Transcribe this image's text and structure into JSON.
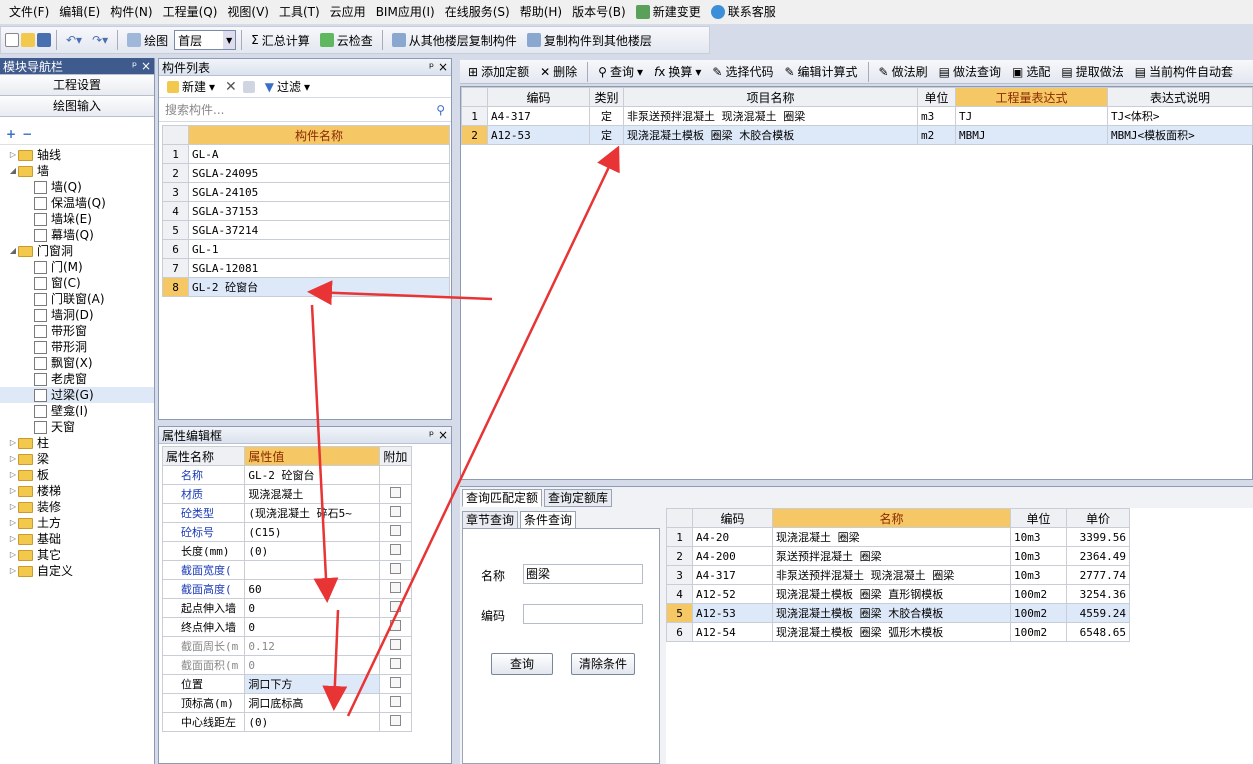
{
  "menu": [
    "文件(F)",
    "编辑(E)",
    "构件(N)",
    "工程量(Q)",
    "视图(V)",
    "工具(T)",
    "云应用",
    "BIM应用(I)",
    "在线服务(S)",
    "帮助(H)",
    "版本号(B)"
  ],
  "menu_extra": [
    "新建变更",
    "联系客服"
  ],
  "toolbar": {
    "draw": "绘图",
    "floor": "首层",
    "sum": "汇总计算",
    "cloud_check": "云检查",
    "copy_from": "从其他楼层复制构件",
    "copy_to": "复制构件到其他楼层"
  },
  "nav": {
    "title": "模块导航栏",
    "buttons": [
      "工程设置",
      "绘图输入"
    ],
    "tree": [
      {
        "label": "轴线",
        "level": 0,
        "exp": "▷",
        "folder": true
      },
      {
        "label": "墙",
        "level": 0,
        "exp": "◢",
        "folder": true
      },
      {
        "label": "墙(Q)",
        "level": 1
      },
      {
        "label": "保温墙(Q)",
        "level": 1
      },
      {
        "label": "墙垛(E)",
        "level": 1
      },
      {
        "label": "幕墙(Q)",
        "level": 1
      },
      {
        "label": "门窗洞",
        "level": 0,
        "exp": "◢",
        "folder": true
      },
      {
        "label": "门(M)",
        "level": 1
      },
      {
        "label": "窗(C)",
        "level": 1
      },
      {
        "label": "门联窗(A)",
        "level": 1
      },
      {
        "label": "墙洞(D)",
        "level": 1
      },
      {
        "label": "带形窗",
        "level": 1
      },
      {
        "label": "带形洞",
        "level": 1
      },
      {
        "label": "飘窗(X)",
        "level": 1
      },
      {
        "label": "老虎窗",
        "level": 1
      },
      {
        "label": "过梁(G)",
        "level": 1,
        "sel": true
      },
      {
        "label": "壁龛(I)",
        "level": 1
      },
      {
        "label": "天窗",
        "level": 1
      },
      {
        "label": "柱",
        "level": 0,
        "exp": "▷",
        "folder": true
      },
      {
        "label": "梁",
        "level": 0,
        "exp": "▷",
        "folder": true
      },
      {
        "label": "板",
        "level": 0,
        "exp": "▷",
        "folder": true
      },
      {
        "label": "楼梯",
        "level": 0,
        "exp": "▷",
        "folder": true
      },
      {
        "label": "装修",
        "level": 0,
        "exp": "▷",
        "folder": true
      },
      {
        "label": "土方",
        "level": 0,
        "exp": "▷",
        "folder": true
      },
      {
        "label": "基础",
        "level": 0,
        "exp": "▷",
        "folder": true
      },
      {
        "label": "其它",
        "level": 0,
        "exp": "▷",
        "folder": true
      },
      {
        "label": "自定义",
        "level": 0,
        "exp": "▷",
        "folder": true
      }
    ]
  },
  "complist": {
    "title": "构件列表",
    "new": "新建",
    "filter": "过滤",
    "search_placeholder": "搜索构件...",
    "col": "构件名称",
    "rows": [
      "GL-A",
      "SGLA-24095",
      "SGLA-24105",
      "SGLA-37153",
      "SGLA-37214",
      "GL-1",
      "SGLA-12081",
      "GL-2 砼窗台"
    ],
    "selected": 8
  },
  "props": {
    "title": "属性编辑框",
    "cols": [
      "属性名称",
      "属性值",
      "附加"
    ],
    "rows": [
      {
        "name": "名称",
        "value": "GL-2 砼窗台",
        "color": "blue",
        "cb": false
      },
      {
        "name": "材质",
        "value": "现浇混凝土",
        "color": "blue",
        "cb": true
      },
      {
        "name": "砼类型",
        "value": "(现浇混凝土  碎石5~",
        "color": "blue",
        "cb": true
      },
      {
        "name": "砼标号",
        "value": "(C15)",
        "color": "blue",
        "cb": true
      },
      {
        "name": "长度(mm)",
        "value": "(0)",
        "color": "black",
        "cb": true
      },
      {
        "name": "截面宽度(",
        "value": "",
        "color": "blue",
        "cb": true
      },
      {
        "name": "截面高度(",
        "value": "60",
        "color": "blue",
        "cb": true
      },
      {
        "name": "起点伸入墙",
        "value": "0",
        "color": "black",
        "cb": true
      },
      {
        "name": "终点伸入墙",
        "value": "0",
        "color": "black",
        "cb": true
      },
      {
        "name": "截面周长(m",
        "value": "0.12",
        "color": "gray",
        "cb": true
      },
      {
        "name": "截面面积(m",
        "value": "0",
        "color": "gray",
        "cb": true
      },
      {
        "name": "位置",
        "value": "洞口下方",
        "color": "black",
        "cb": true,
        "sel": true
      },
      {
        "name": "顶标高(m)",
        "value": "洞口底标高",
        "color": "black",
        "cb": true
      },
      {
        "name": "中心线距左",
        "value": "(0)",
        "color": "black",
        "cb": true
      }
    ]
  },
  "deftool": [
    "添加定额",
    "删除",
    "查询",
    "换算",
    "选择代码",
    "编辑计算式",
    "做法刷",
    "做法查询",
    "选配",
    "提取做法",
    "当前构件自动套"
  ],
  "deftable": {
    "cols": [
      "编码",
      "类别",
      "项目名称",
      "单位",
      "工程量表达式",
      "表达式说明"
    ],
    "rows": [
      {
        "n": "1",
        "code": "A4-317",
        "type": "定",
        "name": "非泵送预拌混凝土 现浇混凝土 圈梁",
        "unit": "m3",
        "expr": "TJ",
        "desc": "TJ<体积>"
      },
      {
        "n": "2",
        "code": "A12-53",
        "type": "定",
        "name": "现浇混凝土模板 圈梁 木胶合模板",
        "unit": "m2",
        "expr": "MBMJ",
        "desc": "MBMJ<模板面积>"
      }
    ]
  },
  "query": {
    "tabs": [
      "查询匹配定额",
      "查询定额库"
    ],
    "subtabs": [
      "章节查询",
      "条件查询"
    ],
    "name_label": "名称",
    "name_value": "圈梁",
    "code_label": "编码",
    "btn_query": "查询",
    "btn_clear": "清除条件",
    "cols": [
      "编码",
      "名称",
      "单位",
      "单价"
    ],
    "rows": [
      {
        "n": "1",
        "code": "A4-20",
        "name": "现浇混凝土 圈梁",
        "unit": "10m3",
        "price": "3399.56"
      },
      {
        "n": "2",
        "code": "A4-200",
        "name": "泵送预拌混凝土 圈梁",
        "unit": "10m3",
        "price": "2364.49"
      },
      {
        "n": "3",
        "code": "A4-317",
        "name": "非泵送预拌混凝土 现浇混凝土 圈梁",
        "unit": "10m3",
        "price": "2777.74"
      },
      {
        "n": "4",
        "code": "A12-52",
        "name": "现浇混凝土模板 圈梁 直形钢模板",
        "unit": "100m2",
        "price": "3254.36"
      },
      {
        "n": "5",
        "code": "A12-53",
        "name": "现浇混凝土模板 圈梁 木胶合模板",
        "unit": "100m2",
        "price": "4559.24"
      },
      {
        "n": "6",
        "code": "A12-54",
        "name": "现浇混凝土模板 圈梁 弧形木模板",
        "unit": "100m2",
        "price": "6548.65"
      }
    ]
  },
  "colors": {
    "header_hi": "#f6c865",
    "arrow": "#e83434",
    "nav_title": "#3f5a8c"
  }
}
